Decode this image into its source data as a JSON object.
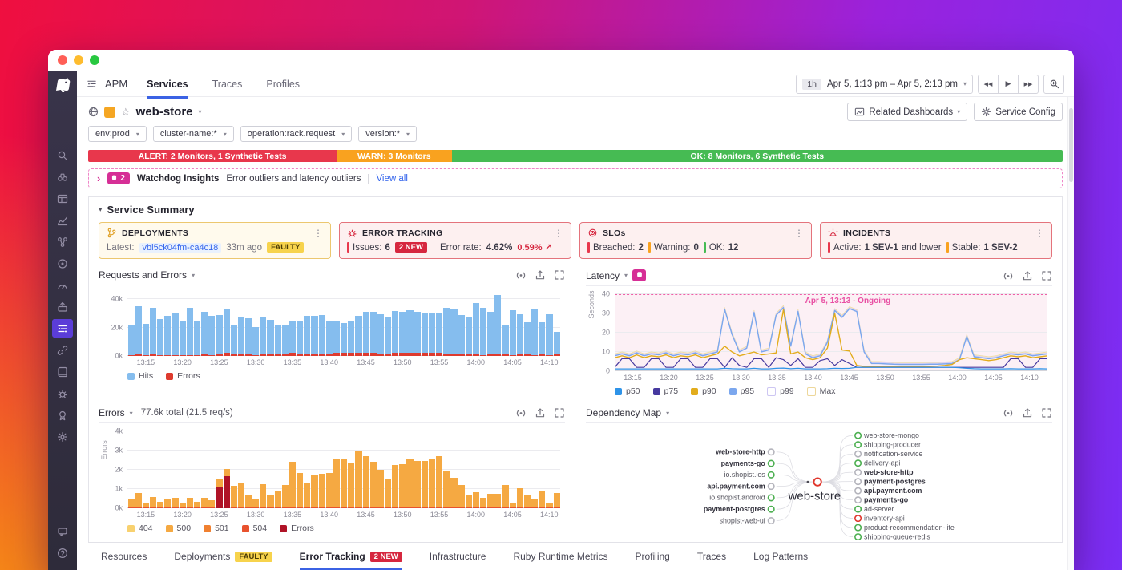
{
  "top_nav": {
    "brand": "APM",
    "tabs": [
      {
        "label": "Services",
        "active": true
      },
      {
        "label": "Traces",
        "active": false
      },
      {
        "label": "Profiles",
        "active": false
      }
    ],
    "time_range": {
      "duration": "1h",
      "label": "Apr 5, 1:13 pm – Apr 5, 2:13 pm"
    }
  },
  "sidebar": {
    "icons": [
      "search",
      "watchdog",
      "dashboards",
      "metrics",
      "infrastructure",
      "monitors",
      "synthetics",
      "ci",
      "apm",
      "service-map",
      "logs",
      "security",
      "compliance",
      "settings"
    ],
    "active": "apm",
    "bottom_icons": [
      "chat",
      "help"
    ]
  },
  "service_header": {
    "title": "web-store",
    "filters": [
      "env:prod",
      "cluster-name:*",
      "operation:rack.request",
      "version:*"
    ],
    "related_dashboards_label": "Related Dashboards",
    "service_config_label": "Service Config"
  },
  "status_bar": {
    "segments": [
      {
        "label": "ALERT: 2 Monitors, 1 Synthetic Tests",
        "color": "#e8374c",
        "width_pct": 25.5
      },
      {
        "label": "WARN: 3 Monitors",
        "color": "#f9a21f",
        "width_pct": 11.8
      },
      {
        "label": "OK: 8 Monitors, 6 Synthetic Tests",
        "color": "#46bb53",
        "width_pct": 62.7
      }
    ]
  },
  "watchdog_bar": {
    "count": "2",
    "title": "Watchdog Insights",
    "subtitle": "Error outliers and latency outliers",
    "link_label": "View all",
    "accent": "#d62f96"
  },
  "service_summary": {
    "heading": "Service Summary",
    "cards": [
      {
        "title": "DEPLOYMENTS",
        "latest_label": "Latest:",
        "commit": "vbi5ck04fm-ca4c18",
        "age": "33m ago",
        "badge": "FAULTY"
      },
      {
        "title": "ERROR TRACKING",
        "issues_label": "Issues:",
        "issues": "6",
        "badge": "2 NEW",
        "error_rate_label": "Error rate:",
        "error_rate": "4.62%",
        "delta": "0.59% ↗"
      },
      {
        "title": "SLOs",
        "items": [
          {
            "label": "Breached:",
            "value": "2",
            "color": "#e8374c"
          },
          {
            "label": "Warning:",
            "value": "0",
            "color": "#f9a21f"
          },
          {
            "label": "OK:",
            "value": "12",
            "color": "#46bb53"
          }
        ]
      },
      {
        "title": "INCIDENTS",
        "items": [
          {
            "label": "Active:",
            "value": "1 SEV-1",
            "suffix": "and lower",
            "color": "#e8374c"
          },
          {
            "label": "Stable:",
            "value": "1 SEV-2",
            "suffix": "",
            "color": "#f9a21f"
          }
        ]
      }
    ]
  },
  "widget_toolbar_icons": [
    "create-monitor",
    "export",
    "fullscreen"
  ],
  "chart_data": [
    {
      "id": "requests",
      "type": "bar",
      "title": "Requests and Errors",
      "ylim": [
        0,
        44
      ],
      "yticks": [
        {
          "v": 0,
          "label": "0k"
        },
        {
          "v": 20,
          "label": "20k"
        },
        {
          "v": 40,
          "label": "40k"
        }
      ],
      "x_ticks": [
        "13:15",
        "13:20",
        "13:25",
        "13:30",
        "13:35",
        "13:40",
        "13:45",
        "13:50",
        "13:55",
        "14:00",
        "14:05",
        "14:10"
      ],
      "series": [
        {
          "name": "Hits",
          "color": "#85bdee",
          "values": [
            22,
            35,
            22.5,
            34,
            26,
            28,
            30.5,
            24,
            34,
            24.5,
            31,
            28,
            29,
            32.5,
            22,
            27.5,
            26.5,
            20.5,
            27.5,
            25.5,
            21.5,
            21.5,
            24,
            24.5,
            28,
            28,
            28.5,
            25,
            24,
            23,
            24.5,
            28,
            31,
            31,
            29.5,
            27.5,
            31.5,
            31,
            32,
            31,
            30.5,
            30,
            30.5,
            34,
            33,
            29,
            27.5,
            37.5,
            34,
            31,
            43,
            22,
            32,
            29.5,
            23.5,
            33,
            23.5,
            29.5,
            17
          ]
        },
        {
          "name": "Errors",
          "color": "#de3b2f",
          "values": [
            0.8,
            0.9,
            0.7,
            0.9,
            0.8,
            0.7,
            0.8,
            0.7,
            0.8,
            0.7,
            0.9,
            0.8,
            1.5,
            2,
            1.2,
            1.3,
            0.9,
            0.8,
            1.2,
            0.9,
            1,
            1.2,
            2,
            1.8,
            1.3,
            1.6,
            1.7,
            1.8,
            2.2,
            2.2,
            2,
            2.5,
            2.3,
            2.1,
            1.8,
            1.4,
            2,
            2,
            2.2,
            2.1,
            2.1,
            2.2,
            2.3,
            1.8,
            1.5,
            1.2,
            0.9,
            1,
            0.8,
            0.9,
            0.9,
            1.2,
            0.6,
            1,
            0.9,
            0.8,
            1,
            0.7,
            0.9
          ]
        }
      ],
      "legend": [
        {
          "label": "Hits",
          "color": "#85bdee"
        },
        {
          "label": "Errors",
          "color": "#de3b2f"
        }
      ]
    },
    {
      "id": "latency",
      "type": "line",
      "title": "Latency",
      "ylabel": "Seconds",
      "ylim": [
        0,
        40
      ],
      "yticks": [
        {
          "v": 0,
          "label": "0"
        },
        {
          "v": 10,
          "label": "10"
        },
        {
          "v": 20,
          "label": "20"
        },
        {
          "v": 30,
          "label": "30"
        },
        {
          "v": 40,
          "label": "40"
        }
      ],
      "x_ticks": [
        "13:15",
        "13:20",
        "13:25",
        "13:30",
        "13:35",
        "13:40",
        "13:45",
        "13:50",
        "13:55",
        "14:00",
        "14:05",
        "14:10"
      ],
      "annotation": {
        "text": "Apr 5, 13:13 - Ongoing",
        "color": "#e84fa3",
        "y": 40
      },
      "series": [
        {
          "name": "p50",
          "color": "#2e93e8",
          "width": 1.2,
          "values": [
            1.2,
            1.2,
            1.2,
            1.2,
            1.2,
            1.2,
            1.2,
            1.2,
            1.2,
            1.2,
            1.2,
            1.2,
            1.2,
            1.2,
            1.2,
            1.5,
            1.3,
            1.2,
            1.2,
            1.5,
            1.2,
            1.2,
            1.5,
            1.6,
            1.3,
            1.5,
            1.2,
            1.2,
            1.2,
            1.3,
            1.5,
            1.4,
            1.5,
            2,
            2,
            2,
            2,
            2,
            2,
            2,
            2,
            2,
            2,
            2,
            2,
            2,
            2,
            1.8,
            1.5,
            1.3,
            1.2,
            1.2,
            1.2,
            1.2,
            1.3,
            1.2,
            1.2,
            1.2,
            1.3,
            1.2
          ]
        },
        {
          "name": "p75",
          "color": "#46399f",
          "width": 1.2,
          "values": [
            2,
            6.5,
            6.5,
            2,
            2,
            6.5,
            6.5,
            2,
            2,
            6.5,
            6.5,
            2,
            2,
            6.5,
            6.5,
            2,
            7,
            3,
            2,
            6.5,
            6.5,
            2,
            7,
            6,
            3,
            6.5,
            2,
            2,
            5.5,
            6.5,
            3,
            6,
            4,
            2,
            2,
            2,
            2,
            2,
            2,
            2,
            2,
            2,
            2,
            2,
            2,
            2,
            2,
            2,
            2,
            2,
            2,
            2,
            2,
            2,
            6.5,
            6.5,
            2,
            2,
            6.5,
            6.5
          ]
        },
        {
          "name": "p90",
          "color": "#e2ac1c",
          "width": 1.4,
          "values": [
            7,
            8,
            7,
            8.5,
            7,
            8,
            7.5,
            8.5,
            7,
            8,
            7.5,
            8.5,
            7,
            8,
            9,
            13,
            10,
            8,
            9,
            10,
            8.5,
            9,
            9.5,
            32,
            9,
            10,
            7,
            6,
            7,
            12,
            30,
            11,
            10.5,
            3,
            2.5,
            2.5,
            2.5,
            2.5,
            2.5,
            2.5,
            2.5,
            2.5,
            2.5,
            2.6,
            2.7,
            3,
            3.5,
            6,
            7,
            6.5,
            6,
            5.5,
            6,
            7,
            8,
            7.5,
            8,
            7,
            7.5,
            8
          ]
        },
        {
          "name": "p95",
          "color": "#7ba7ee",
          "width": 1.4,
          "values": [
            8,
            9,
            8,
            9.5,
            8,
            9,
            8.5,
            9.5,
            8,
            9,
            8.5,
            9.5,
            8,
            9,
            10,
            32,
            19,
            10,
            12,
            30.5,
            10,
            11,
            29,
            33,
            13,
            31,
            9,
            7,
            8,
            15,
            31.5,
            28,
            32.5,
            31,
            10,
            4,
            4,
            3.8,
            3.6,
            3.5,
            3.5,
            3.5,
            3.5,
            3.6,
            3.6,
            3.8,
            4,
            6,
            18,
            7.5,
            7,
            6.5,
            7,
            8,
            9,
            8.5,
            9,
            8,
            8.5,
            9
          ]
        },
        {
          "name": "p99",
          "color": "#d5cef4",
          "width": 1,
          "values": [
            8.5,
            9.5,
            8.5,
            10,
            8.5,
            9.5,
            9,
            10,
            8.5,
            9.5,
            9,
            10,
            8.5,
            9.5,
            10.5,
            32.5,
            19.5,
            10.5,
            12.5,
            31,
            10.5,
            11.5,
            29.5,
            33.5,
            13.5,
            31.5,
            9.5,
            7.5,
            8.5,
            15.5,
            32,
            28.5,
            33,
            31.5,
            10.5,
            4.5,
            4.5,
            4.3,
            4.1,
            4,
            4,
            4,
            4,
            4.1,
            4.1,
            4.3,
            4.5,
            6.5,
            18.5,
            8,
            7.5,
            7,
            7.5,
            8.5,
            9.5,
            9,
            9.5,
            8.5,
            9,
            9.5
          ]
        },
        {
          "name": "Max",
          "color": "#f0dfa6",
          "width": 1,
          "values": [
            9,
            10,
            9,
            10.5,
            9,
            10,
            9.5,
            10.5,
            9,
            10,
            9.5,
            10.5,
            9,
            10,
            11,
            33,
            20,
            11,
            13,
            31.5,
            11,
            12,
            30,
            34,
            14,
            32,
            10,
            8,
            9,
            16,
            32.5,
            29,
            33.5,
            32,
            11,
            5,
            5,
            4.8,
            4.6,
            4.5,
            4.5,
            4.5,
            4.5,
            4.6,
            4.6,
            4.8,
            5,
            7,
            19,
            8.5,
            8,
            7.5,
            8,
            9,
            10,
            9.5,
            10,
            9,
            9.5,
            10
          ]
        }
      ],
      "legend": [
        {
          "label": "p50",
          "color": "#2e93e8"
        },
        {
          "label": "p75",
          "color": "#46399f"
        },
        {
          "label": "p90",
          "color": "#e2ac1c"
        },
        {
          "label": "p95",
          "color": "#7ba7ee"
        },
        {
          "label": "p99",
          "color": "#cdc6f2",
          "outline": true
        },
        {
          "label": "Max",
          "color": "#edd79a",
          "outline": true
        }
      ]
    },
    {
      "id": "errors",
      "type": "bar",
      "title": "Errors",
      "subtitle": "77.6k total (21.5 req/s)",
      "ylabel": "Errors",
      "ylim": [
        0,
        4
      ],
      "yticks": [
        {
          "v": 0,
          "label": "0k"
        },
        {
          "v": 1,
          "label": "1k"
        },
        {
          "v": 2,
          "label": "2k"
        },
        {
          "v": 3,
          "label": "3k"
        },
        {
          "v": 4,
          "label": "4k"
        }
      ],
      "x_ticks": [
        "13:15",
        "13:20",
        "13:25",
        "13:30",
        "13:35",
        "13:40",
        "13:45",
        "13:50",
        "13:55",
        "14:00",
        "14:05",
        "14:10"
      ],
      "series": [
        {
          "name": "500",
          "color": "#f5a942",
          "values": [
            0.5,
            0.8,
            0.3,
            0.6,
            0.35,
            0.45,
            0.55,
            0.3,
            0.55,
            0.35,
            0.55,
            0.4,
            1.5,
            2.05,
            1.15,
            1.35,
            0.65,
            0.5,
            1.25,
            0.65,
            0.9,
            1.2,
            2.4,
            1.85,
            1.35,
            1.75,
            1.8,
            1.85,
            2.55,
            2.6,
            2.35,
            3.0,
            2.7,
            2.4,
            2.0,
            1.5,
            2.25,
            2.3,
            2.6,
            2.45,
            2.45,
            2.6,
            2.7,
            1.95,
            1.6,
            1.2,
            0.65,
            0.85,
            0.55,
            0.75,
            0.75,
            1.2,
            0.25,
            1.05,
            0.7,
            0.5,
            0.9,
            0.3,
            0.8
          ]
        }
      ],
      "overlay": {
        "name": "Errors",
        "color": "#b01327",
        "bars": {
          "12": 1.1,
          "13": 1.65
        }
      },
      "base_strip": {
        "color": "#e8522e"
      },
      "legend": [
        {
          "label": "404",
          "color": "#f8d16f"
        },
        {
          "label": "500",
          "color": "#f5a942"
        },
        {
          "label": "501",
          "color": "#f08030"
        },
        {
          "label": "504",
          "color": "#e8522e"
        },
        {
          "label": "Errors",
          "color": "#b01327"
        }
      ]
    }
  ],
  "dependency_map": {
    "title": "Dependency Map",
    "center": {
      "name": "web-store",
      "color": "red"
    },
    "left": [
      {
        "name": "web-store-http",
        "bold": true,
        "color": "gray"
      },
      {
        "name": "payments-go",
        "bold": true,
        "color": "green"
      },
      {
        "name": "io.shopist.ios",
        "bold": false,
        "color": "green"
      },
      {
        "name": "api.payment.com",
        "bold": true,
        "color": "gray"
      },
      {
        "name": "io.shopist.android",
        "bold": false,
        "color": "green"
      },
      {
        "name": "payment-postgres",
        "bold": true,
        "color": "green"
      },
      {
        "name": "shopist-web-ui",
        "bold": false,
        "color": "gray"
      }
    ],
    "right": [
      {
        "name": "web-store-mongo",
        "bold": false,
        "color": "green"
      },
      {
        "name": "shipping-producer",
        "bold": false,
        "color": "green"
      },
      {
        "name": "notification-service",
        "bold": false,
        "color": "gray"
      },
      {
        "name": "delivery-api",
        "bold": false,
        "color": "green"
      },
      {
        "name": "web-store-http",
        "bold": true,
        "color": "gray"
      },
      {
        "name": "payment-postgres",
        "bold": true,
        "color": "gray"
      },
      {
        "name": "api.payment.com",
        "bold": true,
        "color": "gray"
      },
      {
        "name": "payments-go",
        "bold": true,
        "color": "gray"
      },
      {
        "name": "ad-server",
        "bold": false,
        "color": "green"
      },
      {
        "name": "inventory-api",
        "bold": false,
        "color": "red"
      },
      {
        "name": "product-recommendation-lite",
        "bold": false,
        "color": "green"
      },
      {
        "name": "shipping-queue-redis",
        "bold": false,
        "color": "green"
      }
    ]
  },
  "bottom_tabs": [
    {
      "label": "Resources"
    },
    {
      "label": "Deployments",
      "badge": "FAULTY",
      "badge_style": "yellow"
    },
    {
      "label": "Error Tracking",
      "badge": "2 NEW",
      "badge_style": "red",
      "active": true
    },
    {
      "label": "Infrastructure"
    },
    {
      "label": "Ruby Runtime Metrics"
    },
    {
      "label": "Profiling"
    },
    {
      "label": "Traces"
    },
    {
      "label": "Log Patterns"
    }
  ]
}
